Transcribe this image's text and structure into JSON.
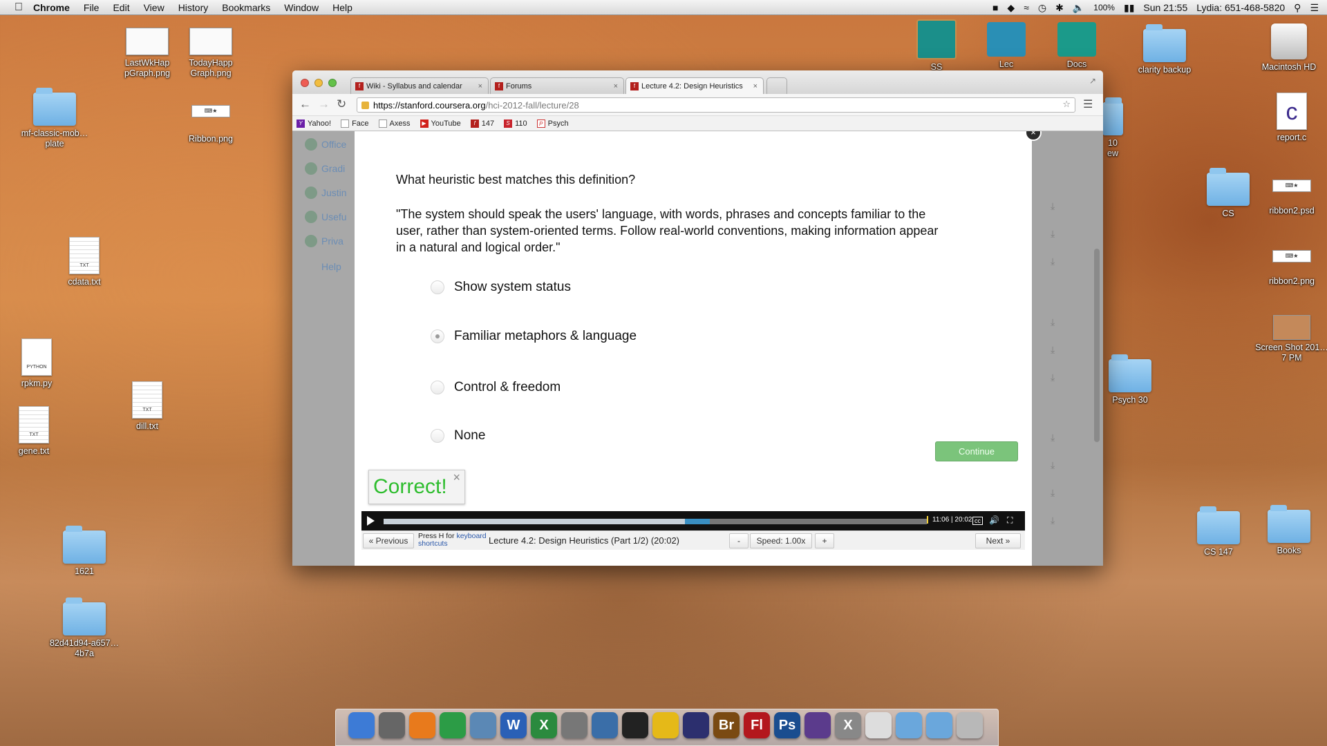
{
  "menubar": {
    "app": "Chrome",
    "items": [
      "File",
      "Edit",
      "View",
      "History",
      "Bookmarks",
      "Window",
      "Help"
    ],
    "battery": "100%",
    "clock": "Sun 21:55",
    "user": "Lydia: 651-468-5820"
  },
  "desktop": {
    "left": [
      "LastWkHap pGraph.png",
      "TodayHapp Graph.png",
      "mf-classic-mob…plate",
      "Ribbon.png",
      "cdata.txt",
      "rpkm.py",
      "gene.txt",
      "dill.txt",
      "1621",
      "82d41d94-a657…4b7a"
    ],
    "right": [
      "Macintosh HD",
      "clarity backup",
      "report.c",
      "CS",
      "ribbon2.psd",
      "ribbon2.png",
      "Screen Shot 201…7 PM",
      "Psych 30",
      "CS 147",
      "Books"
    ],
    "topbar": [
      "SS",
      "Lec",
      "Docs"
    ],
    "partial": [
      "10",
      "ew"
    ]
  },
  "browser": {
    "tabs": [
      {
        "label": "Wiki - Syllabus and calendar"
      },
      {
        "label": "Forums"
      },
      {
        "label": "Lecture 4.2: Design Heuristics"
      }
    ],
    "url_host": "https://stanford.coursera.org",
    "url_path": "/hci-2012-fall/lecture/28",
    "bookmarks": [
      "Yahoo!",
      "Face",
      "Axess",
      "YouTube",
      "147",
      "110",
      "Psych"
    ]
  },
  "sidebar": [
    "Office",
    "Gradi",
    "Justin",
    "Usefu",
    "Priva",
    "Help"
  ],
  "quiz": {
    "question": "What heuristic best matches this definition?",
    "definition": "\"The system should speak the users' language, with words, phrases and concepts familiar to the user, rather than system-oriented terms. Follow real-world conventions, making information appear in a natural and logical order.\"",
    "options": [
      "Show system status",
      "Familiar metaphors & language",
      "Control & freedom",
      "None"
    ],
    "selected_index": 1,
    "continue_label": "Continue",
    "feedback": "Correct!"
  },
  "player": {
    "time": "11:06 | 20:02",
    "progress_fraction": 0.5547,
    "buffered_to_fraction": 0.6
  },
  "lecture_nav": {
    "previous": "« Previous",
    "press_h": "Press H for",
    "keyboard": "keyboard",
    "shortcuts": "shortcuts",
    "title": "Lecture 4.2: Design Heuristics (Part 1/2) (20:02)",
    "minus": "-",
    "speed": "Speed: 1.00x",
    "plus": "+",
    "next": "Next »"
  },
  "dock": [
    {
      "name": "finder-icon",
      "color": "#3d7bd6",
      "label": ""
    },
    {
      "name": "launchpad-icon",
      "color": "#666",
      "label": ""
    },
    {
      "name": "firefox-icon",
      "color": "#e87a1c",
      "label": ""
    },
    {
      "name": "chrome-icon",
      "color": "#2c9c46",
      "label": ""
    },
    {
      "name": "preview-icon",
      "color": "#5b88b5",
      "label": ""
    },
    {
      "name": "word-icon",
      "color": "#2a60b6",
      "label": "W"
    },
    {
      "name": "excel-icon",
      "color": "#2b8a3e",
      "label": "X"
    },
    {
      "name": "system-preferences-icon",
      "color": "#777",
      "label": ""
    },
    {
      "name": "xcode-icon",
      "color": "#3a6ea8",
      "label": ""
    },
    {
      "name": "terminal-icon",
      "color": "#222",
      "label": ""
    },
    {
      "name": "cyberduck-icon",
      "color": "#e5b918",
      "label": ""
    },
    {
      "name": "eclipse-icon",
      "color": "#2c2f6e",
      "label": ""
    },
    {
      "name": "bridge-icon",
      "color": "#7a4a12",
      "label": "Br"
    },
    {
      "name": "flash-icon",
      "color": "#b3171d",
      "label": "Fl"
    },
    {
      "name": "photoshop-icon",
      "color": "#1a4d8f",
      "label": "Ps"
    },
    {
      "name": "inkscape-icon",
      "color": "#5b3b8c",
      "label": ""
    },
    {
      "name": "x11-icon",
      "color": "#888",
      "label": "X"
    },
    {
      "name": "document-icon",
      "color": "#ddd",
      "label": ""
    },
    {
      "name": "applications-folder-icon",
      "color": "#6aa7dc",
      "label": ""
    },
    {
      "name": "documents-folder-icon",
      "color": "#6aa7dc",
      "label": ""
    },
    {
      "name": "trash-icon",
      "color": "#b8b8b8",
      "label": ""
    }
  ]
}
